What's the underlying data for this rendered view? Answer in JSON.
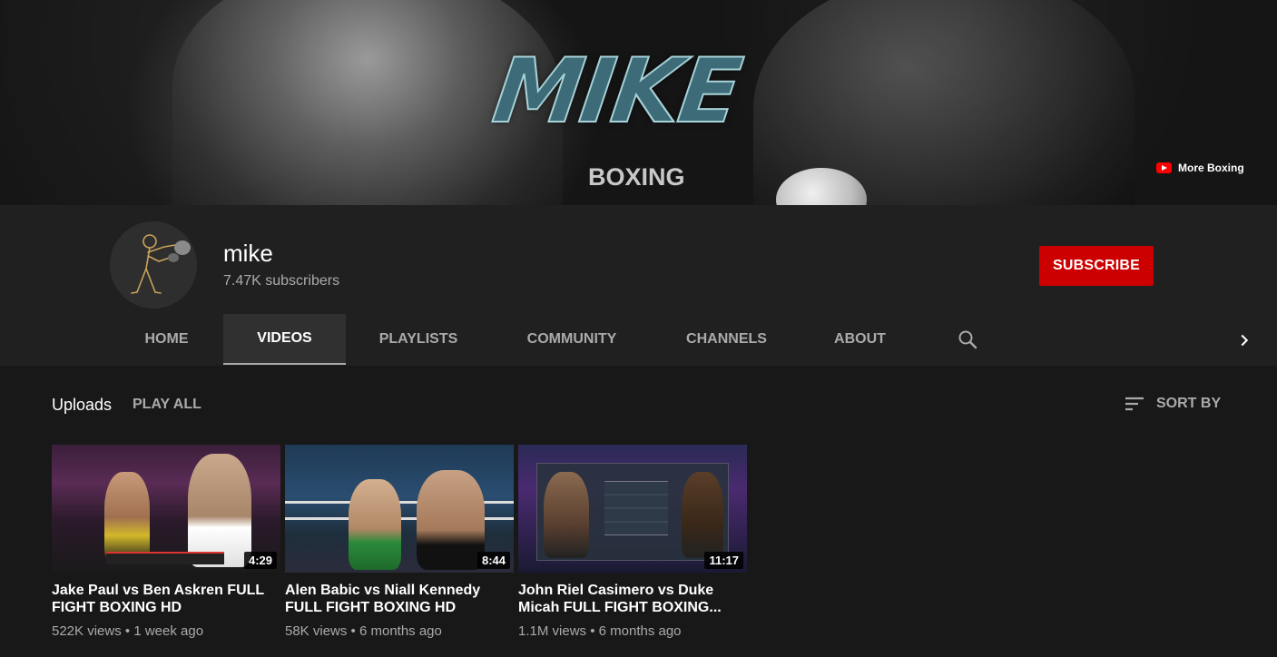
{
  "banner": {
    "logo_text": "MIKE",
    "sub_text": "BOXING",
    "link_label": "More Boxing"
  },
  "channel": {
    "name": "mike",
    "subscribers": "7.47K subscribers",
    "subscribe_label": "SUBSCRIBE"
  },
  "tabs": [
    {
      "label": "HOME",
      "active": false
    },
    {
      "label": "VIDEOS",
      "active": true
    },
    {
      "label": "PLAYLISTS",
      "active": false
    },
    {
      "label": "COMMUNITY",
      "active": false
    },
    {
      "label": "CHANNELS",
      "active": false
    },
    {
      "label": "ABOUT",
      "active": false
    }
  ],
  "icons": {
    "search": "search-icon",
    "next": "chevron-right-icon",
    "sort": "sort-icon",
    "brand": "youtube-icon"
  },
  "colors": {
    "accent": "#cc0000",
    "background": "#181818",
    "header": "#202020",
    "muted_text": "#aaaaaa"
  },
  "uploads": {
    "title": "Uploads",
    "play_all": "PLAY ALL",
    "sort_by": "SORT BY",
    "videos": [
      {
        "title": "Jake Paul vs Ben Askren FULL FIGHT BOXING HD",
        "duration": "4:29",
        "views": "522K views",
        "age": "1 week ago"
      },
      {
        "title": "Alen Babic vs Niall Kennedy FULL FIGHT BOXING HD",
        "duration": "8:44",
        "views": "58K views",
        "age": "6 months ago"
      },
      {
        "title": "John Riel Casimero vs Duke Micah FULL FIGHT BOXING...",
        "duration": "11:17",
        "views": "1.1M views",
        "age": "6 months ago"
      }
    ]
  }
}
